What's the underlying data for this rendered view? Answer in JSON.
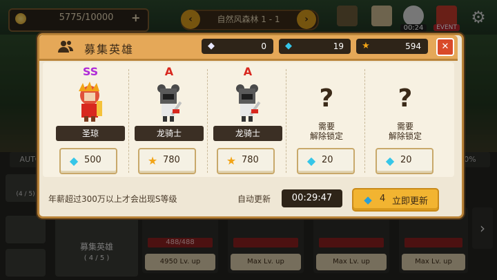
{
  "colors": {
    "grade_ss": "#b02bd8",
    "grade_a": "#d8281f",
    "diamond": "#36c6e8",
    "star": "#f2a416",
    "accent": "#e5a858"
  },
  "hud": {
    "gold": "5775/10000",
    "gold_plus": "+",
    "stage_title": "自然风森林 1 - 1",
    "prev_icon": "chevron-left-icon",
    "next_icon": "chevron-right-icon",
    "timer": "00:24",
    "event_label": "EVENT",
    "settings_icon": "gear-icon"
  },
  "background": {
    "auto_label": "AUTO",
    "percent_label": "0%",
    "side_count": "(4 / 5)",
    "recruit_card_title": "募集英雄",
    "recruit_card_count": "( 4 / 5 )",
    "slots": [
      {
        "hp": "488/488",
        "cost": "4950",
        "lv": "Lv. up"
      },
      {
        "hp": "",
        "cost": "Max",
        "lv": "Lv. up"
      },
      {
        "hp": "",
        "cost": "Max",
        "lv": "Lv. up"
      },
      {
        "hp": "",
        "cost": "Max",
        "lv": "Lv. up"
      }
    ],
    "next_arrow": "›"
  },
  "modal": {
    "title": "募集英雄",
    "title_icon": "users-icon",
    "resources": [
      {
        "icon": "gem-icon",
        "value": "0"
      },
      {
        "icon": "diamond-icon",
        "value": "19"
      },
      {
        "icon": "star-icon",
        "value": "594"
      }
    ],
    "close_label": "✕",
    "heroes": [
      {
        "grade": "SS",
        "name": "圣琼",
        "cost_icon": "diamond-icon",
        "cost": "500"
      },
      {
        "grade": "A",
        "name": "龙骑士",
        "cost_icon": "star-icon",
        "cost": "780"
      },
      {
        "grade": "A",
        "name": "龙骑士",
        "cost_icon": "star-icon",
        "cost": "780"
      }
    ],
    "locked": [
      {
        "mark": "?",
        "text_line1": "需要",
        "text_line2": "解除锁定",
        "cost_icon": "diamond-icon",
        "cost": "20"
      },
      {
        "mark": "?",
        "text_line1": "需要",
        "text_line2": "解除锁定",
        "cost_icon": "diamond-icon",
        "cost": "20"
      }
    ],
    "footer_note": "年薪超过300万以上才会出现S等级",
    "auto_refresh_label": "自动更新",
    "auto_refresh_timer": "00:29:47",
    "refresh_button": {
      "icon": "diamond-icon",
      "count": "4",
      "label": "立即更新"
    }
  }
}
